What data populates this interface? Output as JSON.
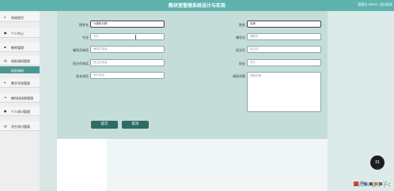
{
  "header": {
    "title": "教研室管理系统设计与实现",
    "user": "管理员 admin",
    "logout": "退出登录"
  },
  "sidebar": {
    "items": [
      {
        "label": "系统首页",
        "icon": "home-icon"
      },
      {
        "label": "个人中心",
        "icon": "user-icon"
      },
      {
        "label": "教师管理",
        "icon": "people-icon"
      },
      {
        "label": "岗前调研管理",
        "icon": "list-icon"
      }
    ],
    "sub_item": "岗前调研",
    "items2": [
      {
        "label": "教学学校管理",
        "icon": "location-icon"
      },
      {
        "label": "教科研成果管理",
        "icon": "gear-icon"
      },
      {
        "label": "个人研讨管理",
        "icon": "user-icon"
      },
      {
        "label": "学生研讨管理",
        "icon": "list-icon"
      }
    ]
  },
  "form": {
    "left": [
      {
        "label": "院系名",
        "value": "计算机分院",
        "placeholder": ""
      },
      {
        "label": "专业",
        "value": "",
        "placeholder": "专业"
      },
      {
        "label": "辅导员电话",
        "value": "",
        "placeholder": "辅导员电话"
      },
      {
        "label": "班主任电话",
        "value": "",
        "placeholder": "班主任电话"
      },
      {
        "label": "班长电话",
        "value": "",
        "placeholder": "班长电话"
      }
    ],
    "right": [
      {
        "label": "院系",
        "value": "名称",
        "placeholder": ""
      },
      {
        "label": "辅导员",
        "value": "",
        "placeholder": "辅导员"
      },
      {
        "label": "班主任",
        "value": "",
        "placeholder": "班主任"
      },
      {
        "label": "班长",
        "value": "",
        "placeholder": "班长"
      }
    ],
    "textarea": {
      "label": "调研详情",
      "placeholder": "调研详情"
    },
    "submit_label": "提交",
    "cancel_label": "取消"
  },
  "overlay": {
    "badge_text": "31",
    "badge_sub": "°/s",
    "watermark": "CSDN @李子c",
    "tray": "中"
  }
}
